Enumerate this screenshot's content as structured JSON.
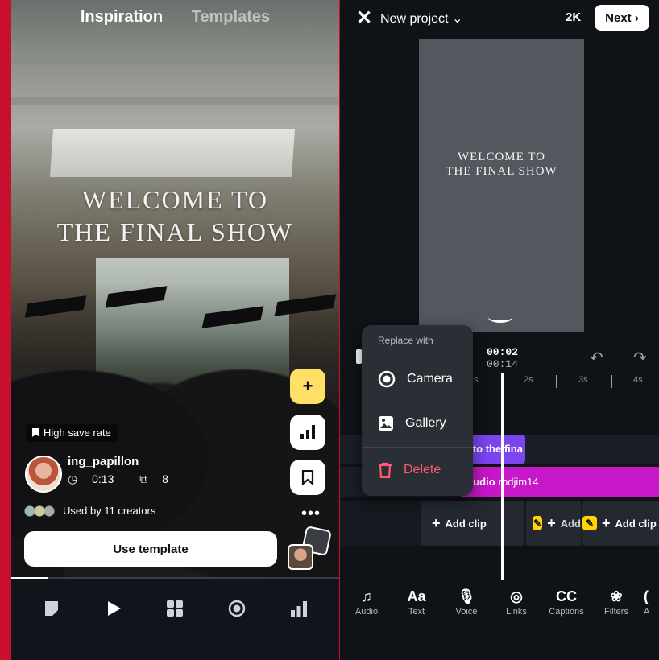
{
  "left_panel": {
    "tabs": {
      "inspiration": "Inspiration",
      "templates": "Templates"
    },
    "video_overlay": {
      "line1": "WELCOME TO",
      "line2": "THE FINAL SHOW"
    },
    "badge": "High save rate",
    "creator": {
      "username": "ing_papillon",
      "duration": "0:13",
      "clips": "8"
    },
    "used_by": "Used by 11 creators",
    "use_template_label": "Use template",
    "side_actions": {
      "add": "+",
      "more": "•••"
    },
    "progress_fraction": 0.11,
    "nav_icons": [
      "templates-icon",
      "play-icon",
      "grid-icon",
      "record-icon",
      "stats-icon"
    ]
  },
  "right_panel": {
    "title": "New project",
    "resolution": "2K",
    "next_label": "Next",
    "preview_text": {
      "line1": "WELCOME TO",
      "line2": "THE FINAL SHOW"
    },
    "timecode": {
      "current": "00:02",
      "total": "00:14"
    },
    "ruler": [
      "1s",
      "2s",
      "3s",
      "4s"
    ],
    "text_clip": "y to the fina",
    "audio_clip": {
      "label": "audio",
      "owner": "rodjim14"
    },
    "add_clip_labels": [
      "Add clip",
      "Add",
      "Add clip"
    ],
    "replace_menu": {
      "header": "Replace with",
      "camera": "Camera",
      "gallery": "Gallery",
      "delete": "Delete"
    },
    "tools": [
      {
        "label": "Audio",
        "icon": "music-note-icon"
      },
      {
        "label": "Text",
        "icon": "text-icon"
      },
      {
        "label": "Voice",
        "icon": "microphone-icon"
      },
      {
        "label": "Links",
        "icon": "instagram-icon"
      },
      {
        "label": "Captions",
        "icon": "captions-icon"
      },
      {
        "label": "Filters",
        "icon": "filters-icon"
      },
      {
        "label": "A",
        "icon": "more-icon"
      }
    ],
    "colors": {
      "text_clip": "#7b45f0",
      "audio_clip": "#c617c8",
      "delete": "#ff5b6e",
      "accent_yellow": "#ffd400"
    }
  }
}
